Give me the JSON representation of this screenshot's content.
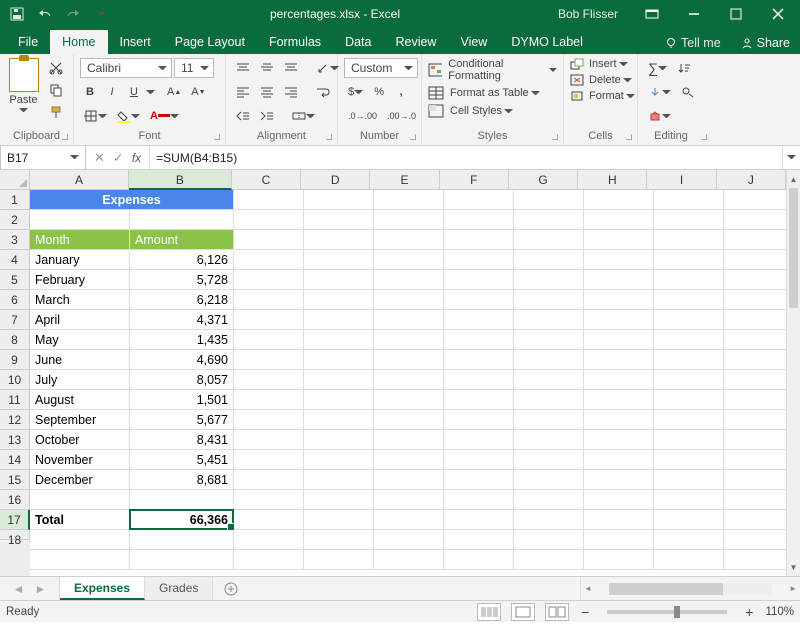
{
  "titlebar": {
    "docname": "percentages.xlsx - Excel",
    "username": "Bob Flisser"
  },
  "tabs": {
    "file": "File",
    "home": "Home",
    "insert": "Insert",
    "pagelayout": "Page Layout",
    "formulas": "Formulas",
    "data": "Data",
    "review": "Review",
    "view": "View",
    "dymo": "DYMO Label",
    "tellme": "Tell me",
    "share": "Share"
  },
  "ribbon": {
    "clipboard": {
      "label": "Clipboard",
      "paste": "Paste"
    },
    "font": {
      "label": "Font",
      "name": "Calibri",
      "size": "11",
      "bold": "B",
      "italic": "I",
      "underline": "U"
    },
    "alignment": {
      "label": "Alignment"
    },
    "number": {
      "label": "Number",
      "format": "Custom"
    },
    "styles": {
      "label": "Styles",
      "cond": "Conditional Formatting",
      "table": "Format as Table",
      "cell": "Cell Styles"
    },
    "cells": {
      "label": "Cells",
      "insert": "Insert",
      "delete": "Delete",
      "format": "Format"
    },
    "editing": {
      "label": "Editing"
    }
  },
  "formula": {
    "namebox": "B17",
    "fx": "fx",
    "value": "=SUM(B4:B15)"
  },
  "columns": [
    "A",
    "B",
    "C",
    "D",
    "E",
    "F",
    "G",
    "H",
    "I",
    "J"
  ],
  "rows": [
    "1",
    "2",
    "3",
    "4",
    "5",
    "6",
    "7",
    "8",
    "9",
    "10",
    "11",
    "12",
    "13",
    "14",
    "15",
    "16",
    "17",
    "18"
  ],
  "sheet": {
    "title": "Expenses",
    "h1": "Month",
    "h2": "Amount",
    "months": [
      "January",
      "February",
      "March",
      "April",
      "May",
      "June",
      "July",
      "August",
      "September",
      "October",
      "November",
      "December"
    ],
    "amounts": [
      "6,126",
      "5,728",
      "6,218",
      "4,371",
      "1,435",
      "4,690",
      "8,057",
      "1,501",
      "5,677",
      "8,431",
      "5,451",
      "8,681"
    ],
    "total_label": "Total",
    "total_value": "66,366"
  },
  "sheettabs": {
    "active": "Expenses",
    "other": "Grades"
  },
  "status": {
    "ready": "Ready",
    "zoom": "110%"
  },
  "chart_data": {
    "type": "table",
    "title": "Expenses",
    "columns": [
      "Month",
      "Amount"
    ],
    "rows": [
      [
        "January",
        6126
      ],
      [
        "February",
        5728
      ],
      [
        "March",
        6218
      ],
      [
        "April",
        4371
      ],
      [
        "May",
        1435
      ],
      [
        "June",
        4690
      ],
      [
        "July",
        8057
      ],
      [
        "August",
        1501
      ],
      [
        "September",
        5677
      ],
      [
        "October",
        8431
      ],
      [
        "November",
        5451
      ],
      [
        "December",
        8681
      ]
    ],
    "total": 66366
  },
  "colwidths": {
    "A": 100,
    "B": 104,
    "rest": 70
  }
}
